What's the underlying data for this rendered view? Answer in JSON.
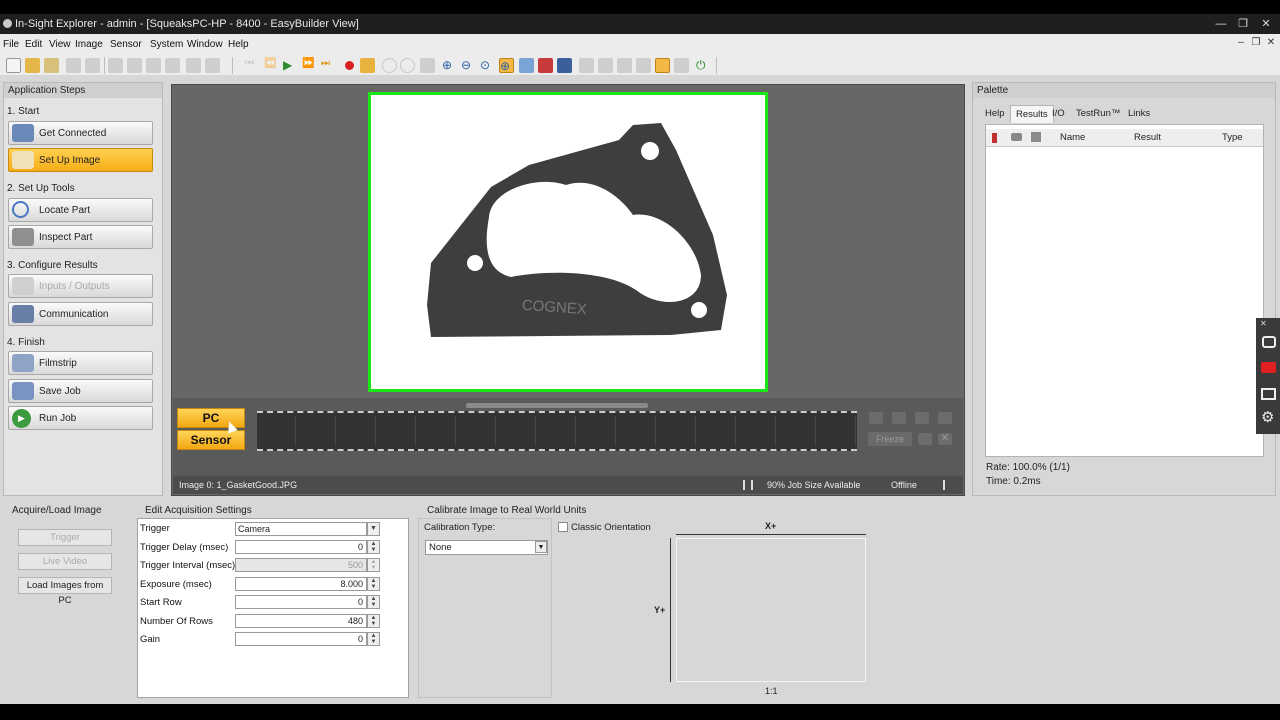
{
  "window": {
    "title": "In-Sight Explorer - admin - [SqueaksPC-HP - 8400 - EasyBuilder View]"
  },
  "menu": [
    "File",
    "Edit",
    "View",
    "Image",
    "Sensor",
    "System",
    "Window",
    "Help"
  ],
  "app_steps": {
    "title": "Application Steps",
    "sections": [
      {
        "label": "1. Start"
      },
      {
        "label": "2. Set Up Tools"
      },
      {
        "label": "3. Configure Results"
      },
      {
        "label": "4. Finish"
      }
    ],
    "buttons": [
      {
        "label": "Get Connected",
        "state": "normal"
      },
      {
        "label": "Set Up Image",
        "state": "active"
      },
      {
        "label": "Locate Part",
        "state": "normal"
      },
      {
        "label": "Inspect Part",
        "state": "normal"
      },
      {
        "label": "Inputs / Outputs",
        "state": "disabled"
      },
      {
        "label": "Communication",
        "state": "normal"
      },
      {
        "label": "Filmstrip",
        "state": "normal"
      },
      {
        "label": "Save Job",
        "state": "normal"
      },
      {
        "label": "Run Job",
        "state": "normal"
      }
    ]
  },
  "viewer": {
    "part_text": "COGNEX",
    "source_pc": "PC",
    "source_sensor": "Sensor",
    "freeze": "Freeze",
    "status": {
      "image": "Image 0: 1_GasketGood.JPG",
      "job_size": "90% Job Size Available",
      "connection": "Offline"
    }
  },
  "palette": {
    "title": "Palette",
    "tabs": [
      {
        "label": "Help",
        "selected": false
      },
      {
        "label": "Results",
        "selected": true
      },
      {
        "label": "I/O",
        "selected": false
      },
      {
        "label": "TestRun™",
        "selected": false
      },
      {
        "label": "Links",
        "selected": false
      }
    ],
    "columns": [
      "Name",
      "Result",
      "Type"
    ],
    "rate": "Rate: 100.0% (1/1)",
    "time": "Time: 0.2ms"
  },
  "acquire": {
    "title": "Acquire/Load Image",
    "trigger": "Trigger",
    "live_video": "Live Video",
    "load_pc": "Load Images from PC"
  },
  "edit_acquisition": {
    "title": "Edit Acquisition Settings",
    "rows": [
      {
        "label": "Trigger",
        "value": "Camera",
        "type": "select"
      },
      {
        "label": "Trigger Delay (msec)",
        "value": "0",
        "type": "spin"
      },
      {
        "label": "Trigger Interval (msec)",
        "value": "500",
        "type": "spin-disabled"
      },
      {
        "label": "Exposure (msec)",
        "value": "8.000",
        "type": "spin"
      },
      {
        "label": "Start Row",
        "value": "0",
        "type": "spin"
      },
      {
        "label": "Number Of Rows",
        "value": "480",
        "type": "spin"
      },
      {
        "label": "Gain",
        "value": "0",
        "type": "spin"
      }
    ]
  },
  "calibrate": {
    "title": "Calibrate Image to Real World Units",
    "type_label": "Calibration Type:",
    "type_value": "None",
    "classic_orientation": "Classic Orientation",
    "x_label": "X+",
    "y_label": "Y+",
    "scale": "1:1"
  },
  "colors": {
    "accent_active": "#f5ad17",
    "image_border": "#19e619",
    "titlebar": "#1f1f1f"
  }
}
